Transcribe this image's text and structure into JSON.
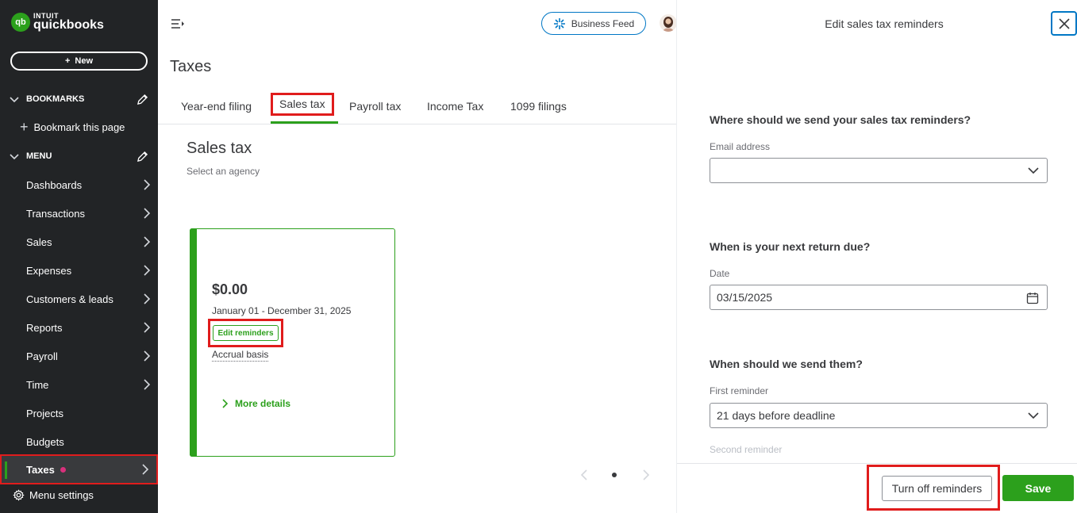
{
  "brand": {
    "intuit": "INTUIT",
    "name": "quickbooks",
    "mark": "qb",
    "accent": "#2ca01c"
  },
  "sidebar": {
    "new_label": "New",
    "bookmarks_label": "BOOKMARKS",
    "bookmark_add_label": "Bookmark this page",
    "menu_label": "MENU",
    "items": [
      {
        "label": "Dashboards",
        "has_arrow": true
      },
      {
        "label": "Transactions",
        "has_arrow": true
      },
      {
        "label": "Sales",
        "has_arrow": true
      },
      {
        "label": "Expenses",
        "has_arrow": true
      },
      {
        "label": "Customers & leads",
        "has_arrow": true
      },
      {
        "label": "Reports",
        "has_arrow": true
      },
      {
        "label": "Payroll",
        "has_arrow": true
      },
      {
        "label": "Time",
        "has_arrow": true
      },
      {
        "label": "Projects",
        "has_arrow": false
      },
      {
        "label": "Budgets",
        "has_arrow": false
      },
      {
        "label": "Taxes",
        "has_arrow": true,
        "active": true
      }
    ],
    "menu_settings_label": "Menu settings"
  },
  "header": {
    "business_feed_label": "Business Feed"
  },
  "page": {
    "title": "Taxes",
    "tabs": [
      {
        "label": "Year-end filing"
      },
      {
        "label": "Sales tax",
        "active": true
      },
      {
        "label": "Payroll tax"
      },
      {
        "label": "Income Tax"
      },
      {
        "label": "1099 filings"
      }
    ],
    "section_title": "Sales tax",
    "section_subtitle": "Select an agency"
  },
  "card": {
    "amount": "$0.00",
    "period": "January 01 - December 31, 2025",
    "edit_reminders_label": "Edit reminders",
    "basis": "Accrual basis",
    "more_details_label": "More details"
  },
  "drawer": {
    "title": "Edit sales tax reminders",
    "q_email": "Where should we send your sales tax reminders?",
    "email_label": "Email address",
    "email_value": "",
    "q_due": "When is your next return due?",
    "date_label": "Date",
    "date_value": "03/15/2025",
    "q_when": "When should we send them?",
    "first_label": "First reminder",
    "first_value": "21 days before deadline",
    "second_label": "Second reminder",
    "turn_off_label": "Turn off reminders",
    "save_label": "Save"
  }
}
